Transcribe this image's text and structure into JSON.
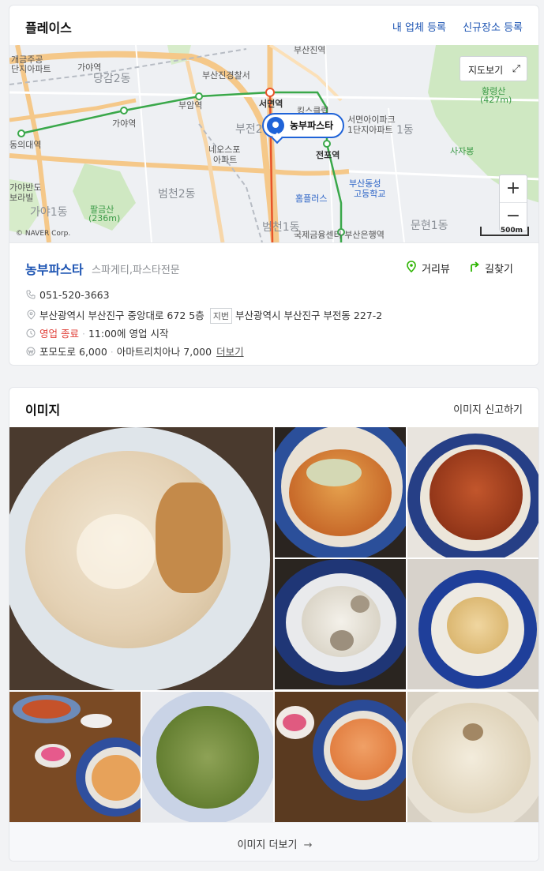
{
  "place_section": {
    "title": "플레이스",
    "my_business_link": "내 업체 등록",
    "new_place_link": "신규장소 등록",
    "map": {
      "view_button": "지도보기",
      "expand_icon": "expand-icon",
      "marker_label": "농부파스타",
      "copyright": "© NAVER Corp.",
      "scale": "500m",
      "zoom_in": "+",
      "zoom_out": "−",
      "labels": {
        "gaemgeum": "개금주공",
        "gaemgeum2": "단지아파트",
        "gaya_a": "가야역",
        "danggam": "당감2동",
        "busanjin_police": "부산진경찰서",
        "busanjin_station": "부산진역",
        "seomyeon_station": "서면역",
        "bujeon2": "부전2",
        "kings_club": "킹스클럽",
        "seomyeon_apt": "서면아이파크",
        "seomyeon_apt2": "1단지아파트",
        "bujeon1": "1동",
        "hwangnyeong": "황령산",
        "hwangnyeong_h": "(427m)",
        "dongui": "동의대역",
        "gaya_station": "가야역",
        "buam_station": "부암역",
        "neo_apt": "네오스포",
        "neo_apt2": "아파트",
        "jeonpo_station": "전포역",
        "busan_dongseong": "부산동성",
        "busan_dongseong2": "고등학교",
        "sajabong": "사자봉",
        "beomcheon2": "범천2동",
        "gaya_bando": "가야반도",
        "boramyeon": "보라빌",
        "palgeum": "팔금산",
        "palgeum_h": "(236m)",
        "gaya1": "가야1동",
        "homeplus": "홈플러스",
        "beomcheon1": "범천1동",
        "munhyeon1": "문현1동",
        "financial": "국제금융센터·부산은행역"
      }
    },
    "place": {
      "name": "농부파스타",
      "category": "스파게티,파스타전문",
      "street_view": "거리뷰",
      "directions": "길찾기",
      "phone": "051-520-3663",
      "address": "부산광역시 부산진구 중앙대로 672 5층",
      "jibun_tag": "지번",
      "jibun_address": "부산광역시 부산진구 부전동 227-2",
      "status": "영업 종료",
      "hours_note": "11:00에 영업 시작",
      "menu": [
        {
          "name": "포모도로",
          "price": "6,000"
        },
        {
          "name": "아마트리치아나",
          "price": "7,000"
        }
      ],
      "menu_more": "더보기"
    },
    "icons": {
      "phone": "phone-icon",
      "address": "location-pin-icon",
      "hours": "clock-icon",
      "menu": "won-icon",
      "street_view": "street-view-pin-icon",
      "directions": "directions-arrow-icon"
    },
    "colors": {
      "brand_blue": "#1e55b3",
      "closed_red": "#e0413a",
      "green": "#2db400"
    }
  },
  "image_section": {
    "title": "이미지",
    "report_link": "이미지 신고하기",
    "more_button": "이미지 더보기",
    "more_icon": "arrow-right-icon",
    "photos": [
      "cream-pasta-photo",
      "seafood-spaghetti-photo",
      "bolognese-photo",
      "mushroom-cream-photo",
      "garlic-pasta-photo",
      "table-pasta-photo",
      "basil-pesto-photo",
      "rose-pasta-photo",
      "carbonara-photo"
    ]
  }
}
